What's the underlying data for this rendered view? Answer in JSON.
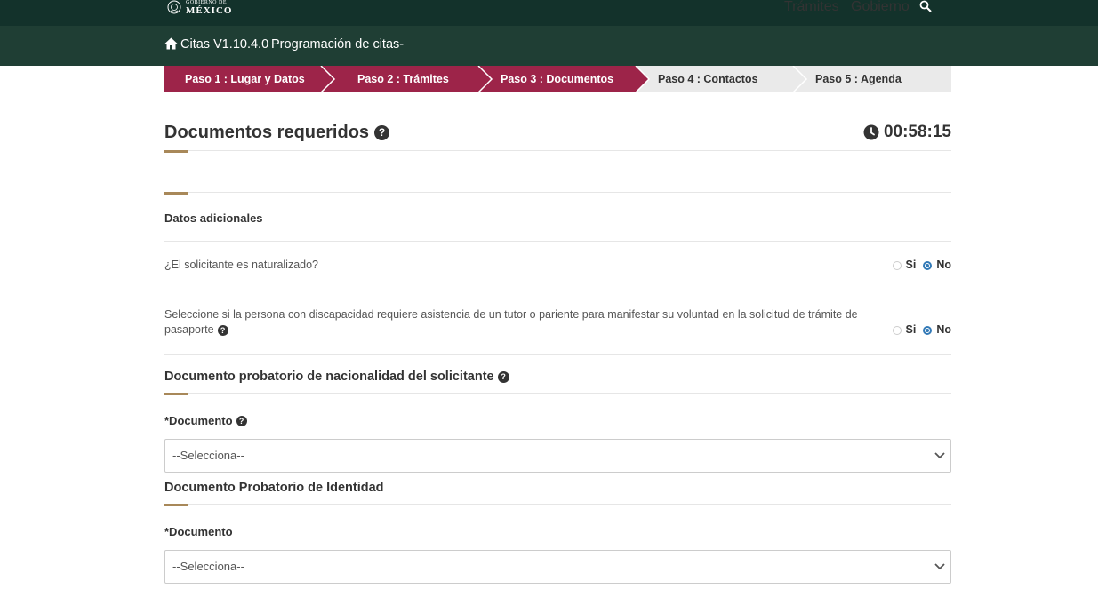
{
  "header": {
    "logo_top": "GOBIERNO DE",
    "logo_main": "MÉXICO",
    "nav": [
      "Trámites",
      "Gobierno"
    ],
    "search_icon": "search-icon"
  },
  "subheader": {
    "title": "Citas V1.10.4.0",
    "subtitle": "Programación de citas-",
    "home_icon": "home-icon"
  },
  "steps": [
    {
      "label": "Paso 1 : Lugar y Datos",
      "active": true
    },
    {
      "label": "Paso 2 : Trámites",
      "active": true
    },
    {
      "label": "Paso 3 : Documentos",
      "active": true
    },
    {
      "label": "Paso 4 : Contactos",
      "active": false
    },
    {
      "label": "Paso 5 : Agenda",
      "active": false
    }
  ],
  "page": {
    "title": "Documentos requeridos",
    "timer": "00:58:15"
  },
  "additional": {
    "heading": "Datos adicionales",
    "q1": {
      "text": "¿El solicitante es naturalizado?",
      "yes": "Si",
      "no": "No",
      "selected": "No"
    },
    "q2": {
      "text_line1": "Seleccione si la persona con discapacidad requiere asistencia de un tutor o pariente para manifestar su voluntad en la solicitud de trámite de",
      "text_line2": "pasaporte",
      "yes": "Si",
      "no": "No",
      "selected": "No"
    }
  },
  "nationality": {
    "heading": "Documento probatorio de nacionalidad del solicitante",
    "label": "*Documento",
    "select_value": "--Selecciona--"
  },
  "identity": {
    "heading": "Documento Probatorio de Identidad",
    "label": "*Documento",
    "select_value": "--Selecciona--"
  },
  "colors": {
    "topbar": "#13322b",
    "subbar": "#1f3e34",
    "step_active": "#9d2449",
    "step_inactive": "#eaeaea",
    "accent": "#a88859"
  }
}
